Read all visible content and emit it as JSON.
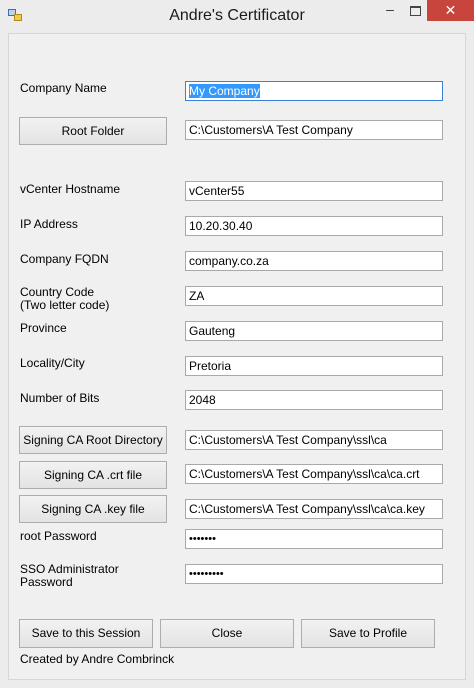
{
  "window": {
    "title": "Andre's Certificator",
    "minimize_glyph": "–",
    "close_glyph": "✕"
  },
  "form": {
    "company_name": {
      "label": "Company Name",
      "value": "My Company"
    },
    "root_folder": {
      "button": "Root Folder",
      "value": "C:\\Customers\\A Test Company"
    },
    "vcenter_hostname": {
      "label": "vCenter Hostname",
      "value": "vCenter55"
    },
    "ip_address": {
      "label": "IP Address",
      "value": "10.20.30.40"
    },
    "company_fqdn": {
      "label": "Company FQDN",
      "value": "company.co.za"
    },
    "country_code": {
      "label": "Country Code\n(Two letter code)",
      "value": "ZA"
    },
    "province": {
      "label": "Province",
      "value": "Gauteng"
    },
    "locality": {
      "label": "Locality/City",
      "value": "Pretoria"
    },
    "number_of_bits": {
      "label": "Number of Bits",
      "value": "2048"
    },
    "signing_ca_root_dir": {
      "button": "Signing CA Root Directory",
      "value": "C:\\Customers\\A Test Company\\ssl\\ca"
    },
    "signing_ca_crt": {
      "button": "Signing CA .crt file",
      "value": "C:\\Customers\\A Test Company\\ssl\\ca\\ca.crt"
    },
    "signing_ca_key": {
      "button": "Signing CA .key file",
      "value": "C:\\Customers\\A Test Company\\ssl\\ca\\ca.key"
    },
    "root_password": {
      "label": "root Password",
      "value": "•••••••"
    },
    "sso_password": {
      "label": "SSO Administrator\nPassword",
      "value": "•••••••••"
    }
  },
  "actions": {
    "save_session": "Save to this Session",
    "close": "Close",
    "save_profile": "Save to Profile"
  },
  "footer": {
    "credit": "Created by Andre Combrinck"
  },
  "colors": {
    "close_button": "#c7453d",
    "selection": "#3399ff",
    "focus_border": "#3c7fd8"
  }
}
